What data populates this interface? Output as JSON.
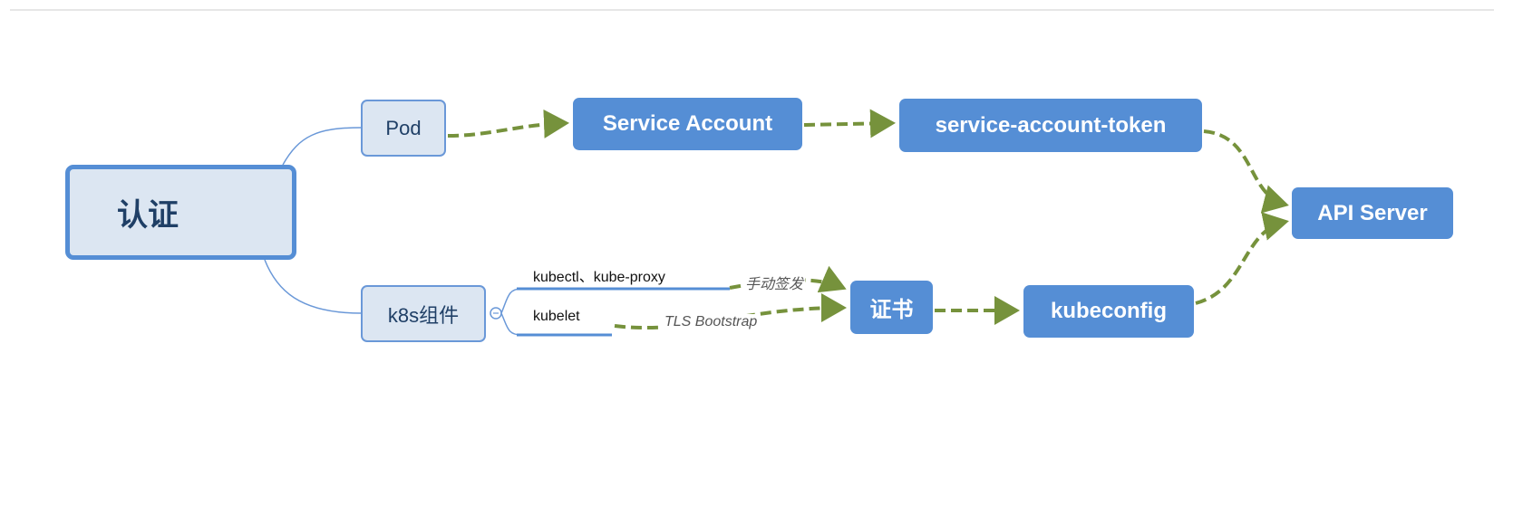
{
  "root": {
    "label": "认证"
  },
  "branches": {
    "pod": {
      "label": "Pod"
    },
    "k8s": {
      "label": "k8s组件"
    }
  },
  "subitems": {
    "kubectl": {
      "label": "kubectl、kube-proxy"
    },
    "kubelet": {
      "label": "kubelet"
    }
  },
  "nodes": {
    "service_account": {
      "label": "Service Account"
    },
    "service_account_token": {
      "label": "service-account-token"
    },
    "api_server": {
      "label": "API Server"
    },
    "cert": {
      "label": "证书"
    },
    "kubeconfig": {
      "label": "kubeconfig"
    }
  },
  "edge_labels": {
    "manual": "手动签发",
    "tls": "TLS Bootstrap"
  },
  "colors": {
    "node_fill": "#558ed5",
    "branch_fill": "#dce6f2",
    "branch_border": "#6a98d8",
    "arrow": "#76923c"
  }
}
